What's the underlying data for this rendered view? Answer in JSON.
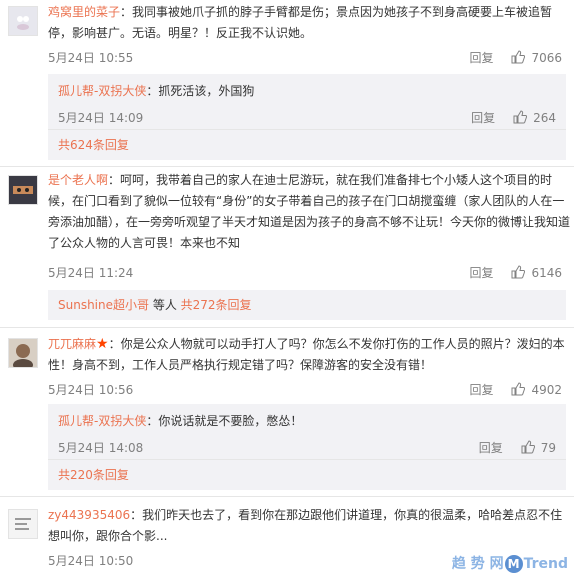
{
  "comments": [
    {
      "user": "鸡窝里的菜子",
      "text": "：我同事被她爪子抓的脖子手臂都是伤；景点因为她孩子不到身高硬要上车被追暂停，影响甚广。无语。明星？！反正我不认识她。",
      "time": "5月24日 10:55",
      "reply_label": "回复",
      "likes": "7066",
      "reply": {
        "user": "孤儿帮-双拐大侠",
        "text": "：抓死活该，外国狗",
        "time": "5月24日 14:09",
        "reply_label": "回复",
        "likes": "264"
      },
      "more_text": "共624条回复"
    },
    {
      "user": "是个老人啊",
      "text": "：呵呵，我带着自己的家人在迪士尼游玩，就在我们准备排七个小矮人这个项目的时候，在门口看到了貌似一位较有“身份”的女子带着自己的孩子在门口胡搅蛮缠（家人团队的人在一旁添油加醋），在一旁旁听观望了半天才知道是因为孩子的身高不够不让玩！今天你的微博让我知道了公众人物的人言可畏！本来也不知",
      "time": "5月24日 11:24",
      "reply_label": "回复",
      "likes": "6146",
      "more_user": "Sunshine超小哥",
      "more_mid": " 等人 ",
      "more_text": "共272条回复"
    },
    {
      "user": "兀兀麻麻",
      "text": "：你是公众人物就可以动手打人了吗？你怎么不发你打伤的工作人员的照片？泼妇的本性！身高不到，工作人员严格执行规定错了吗？保障游客的安全没有错！",
      "time": "5月24日 10:56",
      "reply_label": "回复",
      "likes": "4902",
      "reply": {
        "user": "孤儿帮-双拐大侠",
        "text": "：你说话就是不要脸，憋怂！",
        "time": "5月24日 14:08",
        "reply_label": "回复",
        "likes": "79"
      },
      "more_text": "共220条回复"
    },
    {
      "user": "zy443935406",
      "text": "：我们昨天也去了，看到你在那边跟他们讲道理，你真的很温柔，哈哈差点忍不住想叫你，跟你合个影...",
      "time": "5月24日 10:50"
    }
  ],
  "watermark": {
    "left": "趋 势 网",
    "m": "M",
    "right": "Trend"
  },
  "colors": {
    "username": "#eb7350",
    "meta": "#808080",
    "reply_bg": "#f2f2f5"
  },
  "icons": [
    "thumbs-up-icon",
    "star-icon",
    "avatar"
  ]
}
